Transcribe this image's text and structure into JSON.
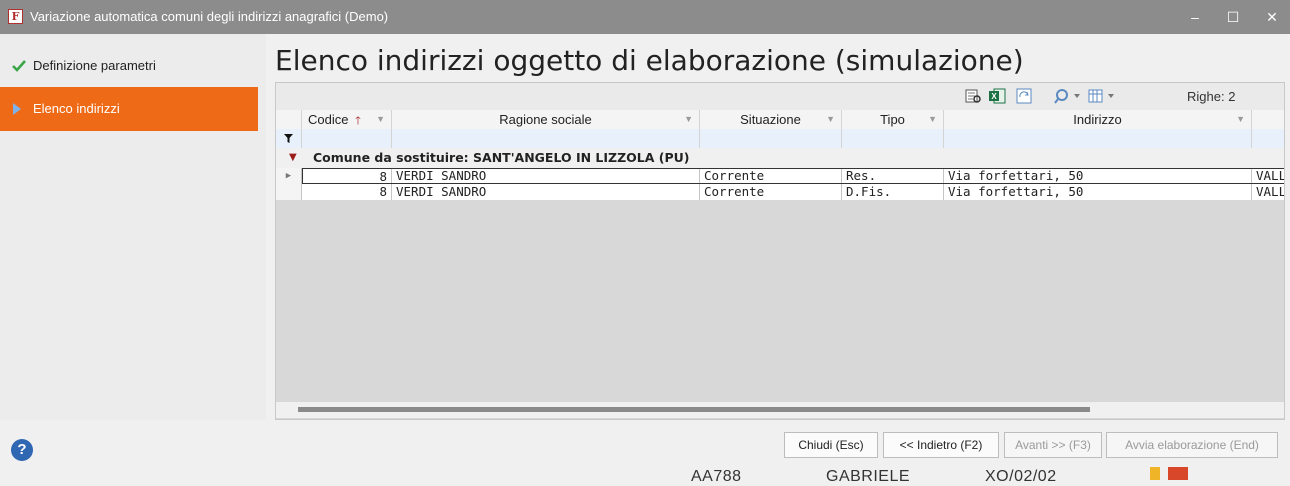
{
  "window": {
    "title": "Variazione automatica comuni degli indirizzi anagrafici  (Demo)",
    "app_icon": "F",
    "controls": {
      "minimize": "–",
      "maximize": "☐",
      "close": "✕"
    }
  },
  "sidebar": {
    "items": [
      {
        "label": "Definizione parametri",
        "state": "done",
        "icon": "check-icon"
      },
      {
        "label": "Elenco indirizzi",
        "state": "active",
        "icon": "arrow-right-icon"
      }
    ]
  },
  "main": {
    "title": "Elenco indirizzi oggetto di elaborazione (simulazione)"
  },
  "grid": {
    "rows_label": "Righe: 2",
    "columns": [
      "Codice",
      "Ragione sociale",
      "Situazione",
      "Tipo",
      "Indirizzo"
    ],
    "group_label": "Comune da sostituire:  SANT'ANGELO IN LIZZOLA (PU)",
    "rows": [
      {
        "codice": "8",
        "ragione": "VERDI SANDRO",
        "situazione": "Corrente",
        "tipo": "Res.",
        "indirizzo": "Via forfettari, 50",
        "extra": "VALL"
      },
      {
        "codice": "8",
        "ragione": "VERDI SANDRO",
        "situazione": "Corrente",
        "tipo": "D.Fis.",
        "indirizzo": "Via forfettari, 50",
        "extra": "VALL"
      }
    ]
  },
  "buttons": {
    "close": "Chiudi (Esc)",
    "back": "<< Indietro (F2)",
    "next": "Avanti >> (F3)",
    "start": "Avvia elaborazione (End)"
  },
  "statusbar": {
    "code": "AA788",
    "user": "GABRIELE",
    "date": "XO/02/02"
  },
  "colors": {
    "accent": "#ef6a16",
    "titlebar": "#8c8c8c",
    "check": "#3aa648",
    "sort_arrow": "#a01f1f"
  }
}
